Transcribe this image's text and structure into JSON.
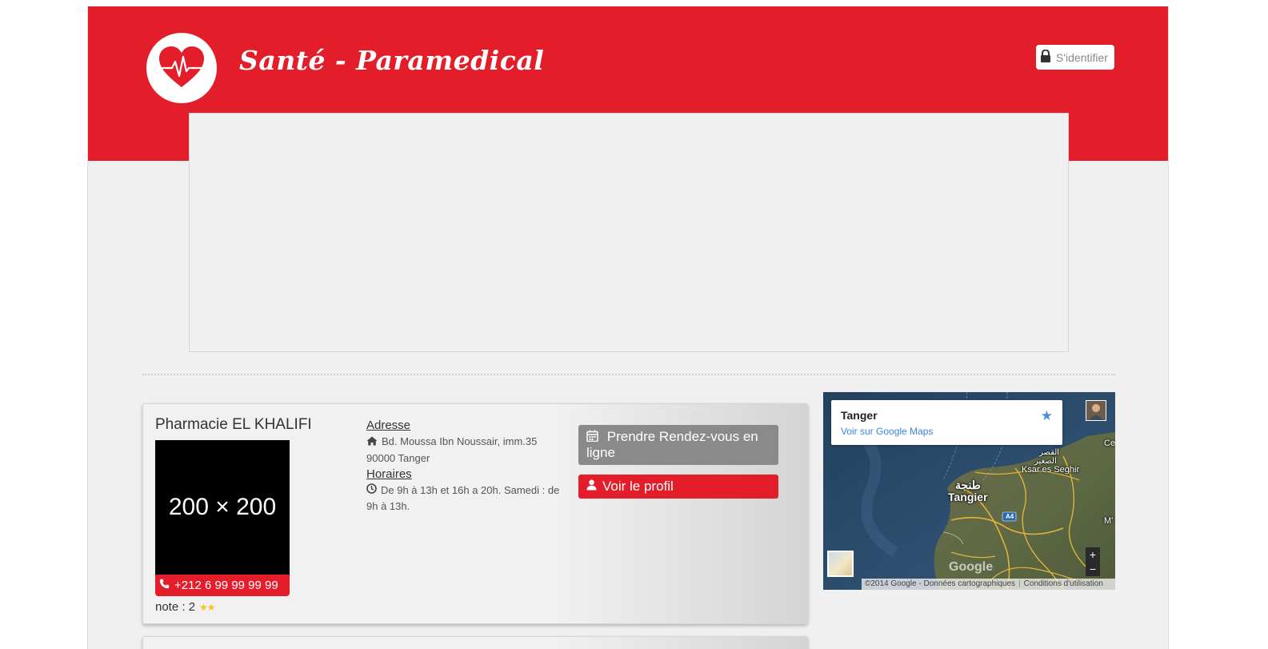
{
  "colors": {
    "brand_red": "#e31e2a",
    "page_bg": "#f0f0f0",
    "button_gray": "#8a8a8a",
    "link_blue": "#3a84df",
    "star_gold": "#f5c518"
  },
  "header": {
    "logo_icon": "heart-pulse-icon",
    "title": "Santé - Paramedical",
    "login_label": "S'identifier",
    "login_icon": "lock-icon"
  },
  "listing": {
    "name": "Pharmacie EL KHALIFI",
    "image_placeholder": "200 × 200",
    "phone": "+212 6 99 99 99 99",
    "phone_icon": "phone-icon",
    "rating_label": "note : 2",
    "rating_value": 2,
    "address_heading": "Adresse",
    "address_line1": "Bd. Moussa Ibn Noussair, imm.35",
    "address_line2": "90000 Tanger",
    "address_icon": "home-icon",
    "hours_heading": "Horaires",
    "hours_text": "De 9h à 13h et 16h a 20h. Samedi : de 9h à 13h.",
    "hours_icon": "clock-icon",
    "appointment_button": "Prendre Rendez-vous en ligne",
    "appointment_icon": "calendar-icon",
    "profile_button": "Voir le profil",
    "profile_icon": "user-icon"
  },
  "map": {
    "place_name": "Tanger",
    "view_link": "Voir sur Google Maps",
    "labels": {
      "tangier_ar": "طنجة",
      "tangier": "Tangier",
      "ksar_es_seghir": "Ksar es Seghir",
      "ksar_ar_1": "القصر",
      "ksar_ar_2": "الصغير",
      "ce": "Ce",
      "a4": "A4",
      "m": "M'"
    },
    "zoom_in": "+",
    "zoom_out": "−",
    "google_mark": "Google",
    "copyright": "©2014 Google - Données cartographiques",
    "terms": "Conditions d'utilisation"
  }
}
